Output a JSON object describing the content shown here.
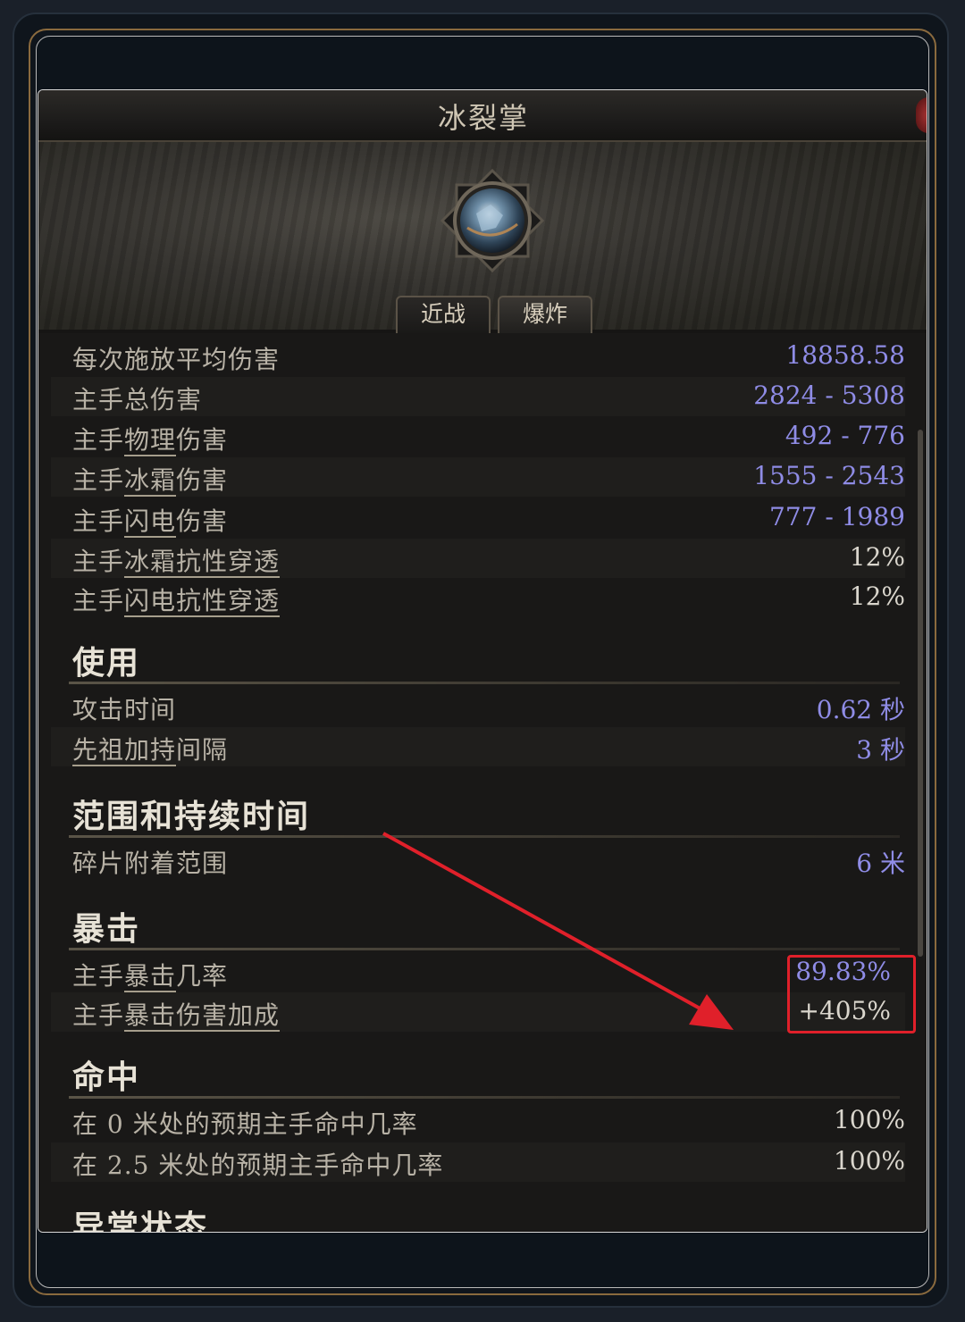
{
  "skill": {
    "title": "冰裂掌",
    "icon": "frost-palm-skill-icon",
    "tabs": [
      {
        "label": "近战",
        "active": true
      },
      {
        "label": "爆炸",
        "active": false
      }
    ]
  },
  "damage_rows": [
    {
      "label": "每次施放平均伤害",
      "value": "18858.58"
    },
    {
      "label": "主手总伤害",
      "value": "2824 - 5308"
    },
    {
      "label_prefix": "主手",
      "label_link": "物理",
      "label_suffix": "伤害",
      "value": "492 - 776"
    },
    {
      "label_prefix": "主手",
      "label_link": "冰霜",
      "label_suffix": "伤害",
      "value": "1555 - 2543"
    },
    {
      "label_prefix": "主手",
      "label_link": "闪电",
      "label_suffix": "伤害",
      "value": "777 - 1989"
    },
    {
      "label_prefix": "主手",
      "label_link": "冰霜抗性穿透",
      "label_suffix": "",
      "value": "12%"
    },
    {
      "label_prefix": "主手",
      "label_link": "闪电抗性穿透",
      "label_suffix": "",
      "value": "12%"
    }
  ],
  "sections": {
    "usage": {
      "title": "使用",
      "rows": [
        {
          "label": "攻击时间",
          "value": "0.62 秒"
        },
        {
          "label_link": "先祖加持",
          "label_suffix": "间隔",
          "value": "3 秒"
        }
      ]
    },
    "area": {
      "title": "范围和持续时间",
      "rows": [
        {
          "label": "碎片附着范围",
          "value": "6 米"
        }
      ]
    },
    "crit": {
      "title": "暴击",
      "rows": [
        {
          "label_prefix": "主手",
          "label_link": "暴击",
          "label_suffix": "几率",
          "value": "89.83%"
        },
        {
          "label_prefix": "主手",
          "label_link": "暴击伤害加成",
          "label_suffix": "",
          "value": "+405%"
        }
      ]
    },
    "hit": {
      "title": "命中",
      "rows": [
        {
          "label": "在 0 米处的预期主手命中几率",
          "value": "100%"
        },
        {
          "label": "在 2.5 米处的预期主手命中几率",
          "value": "100%"
        }
      ]
    },
    "status": {
      "title": "异常状态"
    }
  },
  "colors": {
    "value_blue": "#8f8ce6",
    "value_white": "#dad6cd",
    "annotation_red": "#e0202a"
  }
}
